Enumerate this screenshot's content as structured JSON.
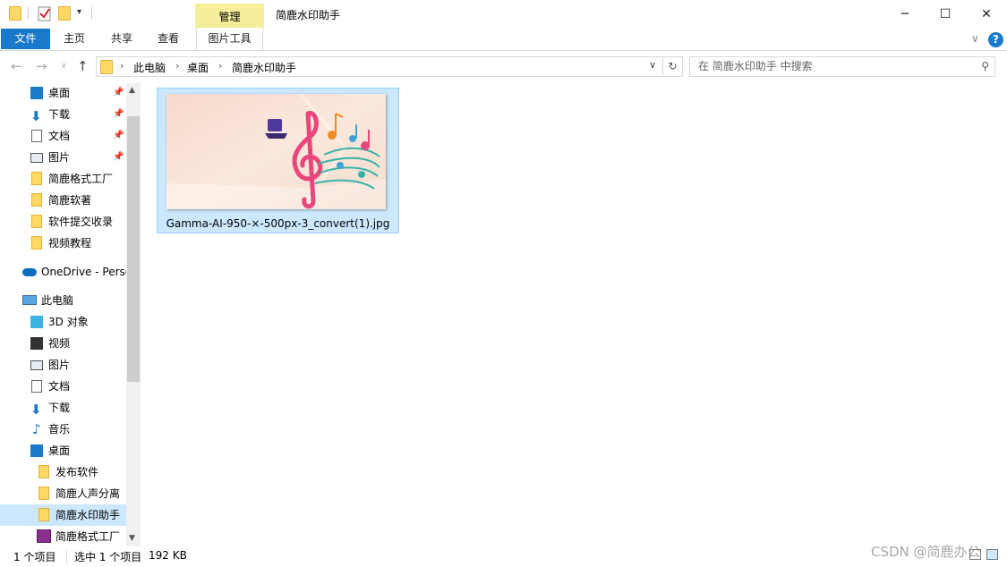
{
  "window": {
    "title": "简鹿水印助手",
    "context_tab_group": "管理",
    "minimize_glyph": "─",
    "maximize_glyph": "☐",
    "close_glyph": "✕"
  },
  "ribbon": {
    "tabs": [
      {
        "label": "文件"
      },
      {
        "label": "主页"
      },
      {
        "label": "共享"
      },
      {
        "label": "查看"
      },
      {
        "label": "图片工具"
      }
    ],
    "help_glyph": "?",
    "accent_color": "#1979ca"
  },
  "address_bar": {
    "crumbs": [
      "此电脑",
      "桌面",
      "简鹿水印助手"
    ],
    "search_placeholder": "在 简鹿水印助手 中搜索"
  },
  "nav_pane": {
    "quick_access": [
      {
        "label": "桌面",
        "icon": "desktop-icon",
        "pinned": true
      },
      {
        "label": "下载",
        "icon": "download-icon",
        "pinned": true
      },
      {
        "label": "文档",
        "icon": "document-icon",
        "pinned": true
      },
      {
        "label": "图片",
        "icon": "pictures-icon",
        "pinned": true
      },
      {
        "label": "简鹿格式工厂",
        "icon": "folder-icon"
      },
      {
        "label": "简鹿软著",
        "icon": "folder-icon"
      },
      {
        "label": "软件提交收录",
        "icon": "folder-icon"
      },
      {
        "label": "视频教程",
        "icon": "folder-icon"
      }
    ],
    "onedrive": {
      "label": "OneDrive - Perso",
      "icon": "onedrive-icon"
    },
    "this_pc": {
      "label": "此电脑",
      "icon": "computer-icon",
      "children": [
        {
          "label": "3D 对象",
          "icon": "3d-objects-icon"
        },
        {
          "label": "视频",
          "icon": "video-icon"
        },
        {
          "label": "图片",
          "icon": "pictures-icon"
        },
        {
          "label": "文档",
          "icon": "document-icon"
        },
        {
          "label": "下载",
          "icon": "download-icon"
        },
        {
          "label": "音乐",
          "icon": "music-icon"
        },
        {
          "label": "桌面",
          "icon": "desktop-icon"
        }
      ]
    },
    "desktop_children": [
      {
        "label": "发布软件",
        "icon": "folder-icon"
      },
      {
        "label": "简鹿人声分离",
        "icon": "folder-icon"
      },
      {
        "label": "简鹿水印助手",
        "icon": "folder-icon",
        "selected": true
      },
      {
        "label": "简鹿格式工厂",
        "icon": "rar-icon"
      }
    ]
  },
  "content": {
    "files": [
      {
        "name": "Gamma-AI-950-×-500px-3_convert(1).jpg",
        "selected": true
      }
    ]
  },
  "status_bar": {
    "item_count": "1 个项目",
    "selected": "选中 1 个项目",
    "size": "192 KB"
  },
  "watermark": "CSDN @简鹿办公"
}
